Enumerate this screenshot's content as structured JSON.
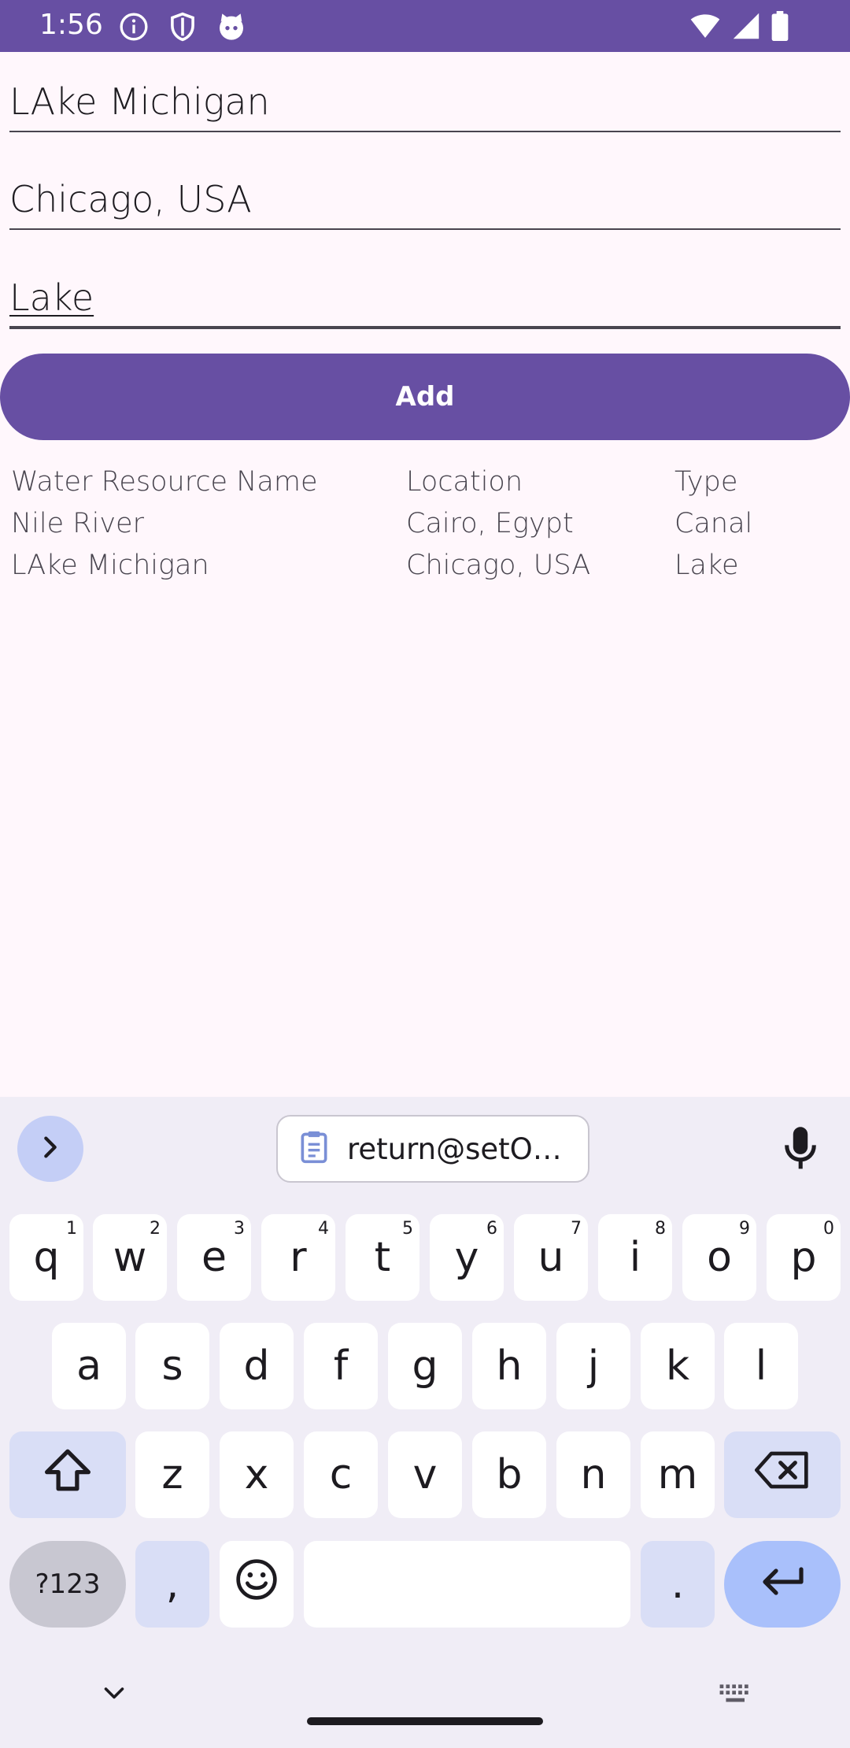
{
  "status_bar": {
    "time": "1:56",
    "left_icons": [
      "info-icon",
      "shield-icon",
      "cat-icon"
    ],
    "right_icons": [
      "wifi-icon",
      "signal-icon",
      "battery-icon"
    ]
  },
  "form": {
    "name_value": "LAke Michigan",
    "location_value": "Chicago, USA",
    "type_value": "Lake",
    "add_label": "Add"
  },
  "table": {
    "headers": [
      "Water Resource Name",
      "Location",
      "Type"
    ],
    "rows": [
      [
        "Nile River",
        "Cairo, Egypt",
        "Canal"
      ],
      [
        "LAke Michigan",
        "Chicago, USA",
        "Lake"
      ]
    ]
  },
  "keyboard": {
    "clipboard_text": "return@setO…",
    "row1": [
      {
        "k": "q",
        "s": "1"
      },
      {
        "k": "w",
        "s": "2"
      },
      {
        "k": "e",
        "s": "3"
      },
      {
        "k": "r",
        "s": "4"
      },
      {
        "k": "t",
        "s": "5"
      },
      {
        "k": "y",
        "s": "6"
      },
      {
        "k": "u",
        "s": "7"
      },
      {
        "k": "i",
        "s": "8"
      },
      {
        "k": "o",
        "s": "9"
      },
      {
        "k": "p",
        "s": "0"
      }
    ],
    "row2": [
      "a",
      "s",
      "d",
      "f",
      "g",
      "h",
      "j",
      "k",
      "l"
    ],
    "row3": [
      "z",
      "x",
      "c",
      "v",
      "b",
      "n",
      "m"
    ],
    "symbols_label": "?123",
    "comma_label": ",",
    "period_label": "."
  },
  "colors": {
    "primary": "#674FA3",
    "background": "#FFF7FC",
    "keyboard_bg": "#F0EDF6",
    "enter_key": "#A9C0FB"
  }
}
